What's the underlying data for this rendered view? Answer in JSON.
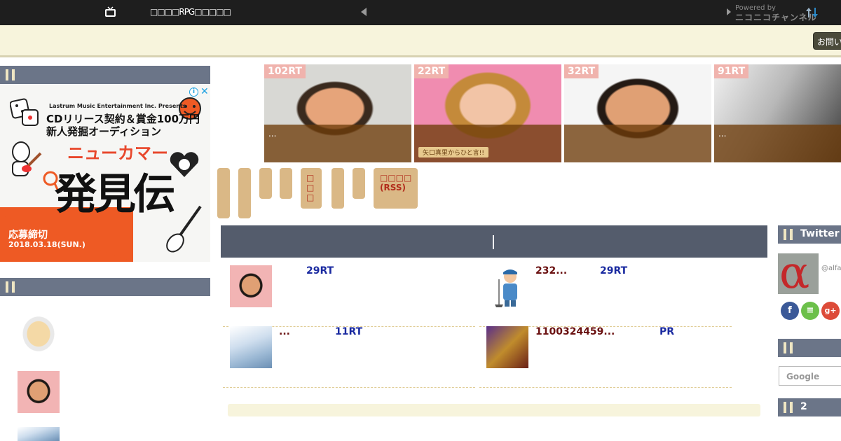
{
  "topbar": {
    "title": "□□□□RPG□□□□□",
    "powered_by": "Powered by",
    "channel_name": "ニコニコチャンネル"
  },
  "banner": {
    "inquiry_label": "お問い"
  },
  "left_sidebar": {
    "section1_label": "",
    "section2_label": "",
    "ad": {
      "presenter": "Lastrum Music Entertainment Inc. Presents",
      "line1": "CDリリース契約＆賞金100万円",
      "line2": "新人発掘オーディション",
      "newcomer": "ニューカマー",
      "big_title": "発見伝",
      "deadline_label": "応募締切",
      "deadline_date": "2018.03.18(SUN.)"
    }
  },
  "carousel": [
    {
      "rt": "102RT",
      "caption": "...",
      "tag": ""
    },
    {
      "rt": "22RT",
      "caption": "",
      "tag": "矢口真里からひと言!!"
    },
    {
      "rt": "32RT",
      "caption": "",
      "tag": ""
    },
    {
      "rt": "91RT",
      "caption": "...",
      "tag": ""
    }
  ],
  "category_tabs": [
    {
      "label": ""
    },
    {
      "label": ""
    },
    {
      "label": ""
    },
    {
      "label": ""
    },
    {
      "label": "□□□"
    },
    {
      "label": ""
    },
    {
      "label": ""
    },
    {
      "label": "□□□□ (RSS)"
    }
  ],
  "entries": [
    {
      "title": "",
      "rt": "29RT"
    },
    {
      "title": "232...",
      "rt": "29RT"
    },
    {
      "title": "...",
      "rt": "11RT"
    },
    {
      "title": "1100324459...",
      "rt": "PR"
    }
  ],
  "right_sidebar": {
    "twitter_label": "Twitter",
    "twitter_handle": "@alfa",
    "search_section_label": "",
    "search_placeholder": "Google",
    "ranking_label": "2"
  },
  "colors": {
    "topbar": "#1e1e1e",
    "banner": "#f7f4dc",
    "section_header": "#6b7588",
    "content_header": "#545c6c",
    "category_tab": "#dab886",
    "rt_badge": "#f0b3ad",
    "entry_title": "#6a1010",
    "entry_rt": "#1a2aa0"
  },
  "icons": [
    "tv-icon",
    "sort-icon",
    "info-icon",
    "close-icon",
    "facebook-icon",
    "feedly-icon",
    "google-plus-icon"
  ]
}
